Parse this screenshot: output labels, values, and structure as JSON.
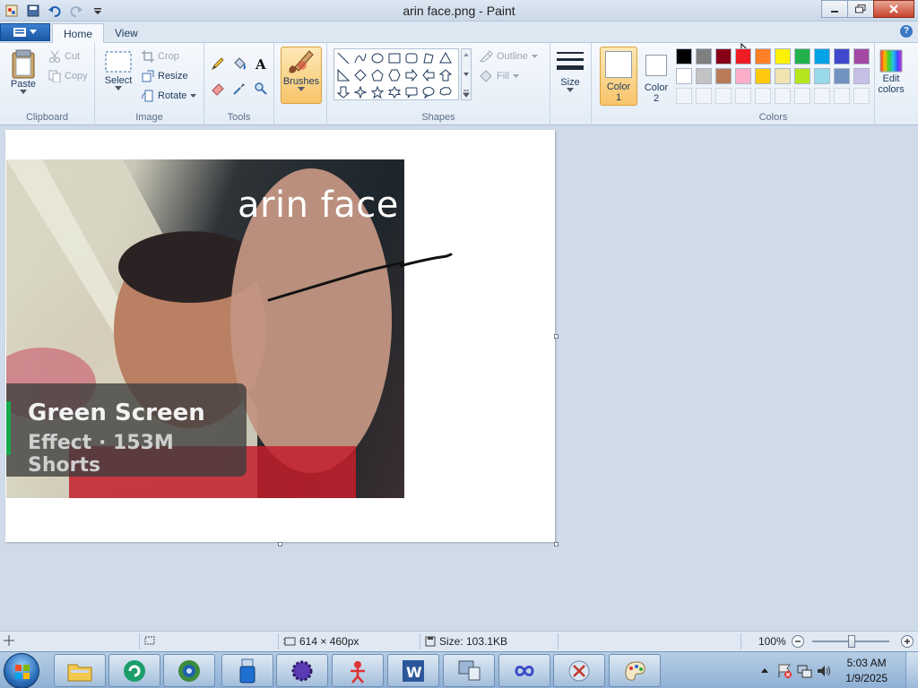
{
  "window": {
    "title": "arin face.png - Paint"
  },
  "tabs": [
    {
      "label": "Home"
    },
    {
      "label": "View"
    }
  ],
  "clipboard": {
    "paste": "Paste",
    "cut": "Cut",
    "copy": "Copy",
    "group": "Clipboard"
  },
  "image": {
    "select": "Select",
    "crop": "Crop",
    "resize": "Resize",
    "rotate": "Rotate",
    "group": "Image"
  },
  "tools": {
    "group": "Tools",
    "brushes": "Brushes"
  },
  "shapes": {
    "outline": "Outline",
    "fill": "Fill",
    "group": "Shapes"
  },
  "size": {
    "label": "Size"
  },
  "colors": {
    "color1_l1": "Color",
    "color1_l2": "1",
    "color2_l1": "Color",
    "color2_l2": "2",
    "edit_l1": "Edit",
    "edit_l2": "colors",
    "group": "Colors",
    "row1": [
      "#000000",
      "#7f7f7f",
      "#880015",
      "#ed1c24",
      "#ff7f27",
      "#fff200",
      "#22b14c",
      "#00a2e8",
      "#3f48cc",
      "#a349a4"
    ],
    "row2": [
      "#ffffff",
      "#c3c3c3",
      "#b97a57",
      "#ffaec9",
      "#ffc90e",
      "#efe4b0",
      "#b5e61d",
      "#99d9ea",
      "#7092be",
      "#c8bfe7"
    ]
  },
  "canvas_image": {
    "title": "arin face",
    "overlay_title": "Green Screen",
    "overlay_sub": "Effect · 153M Shorts"
  },
  "status": {
    "dimensions": "614 × 460px",
    "size": "Size: 103.1KB",
    "zoom": "100%"
  },
  "clock": {
    "time": "5:03 AM",
    "date": "1/9/2025"
  }
}
